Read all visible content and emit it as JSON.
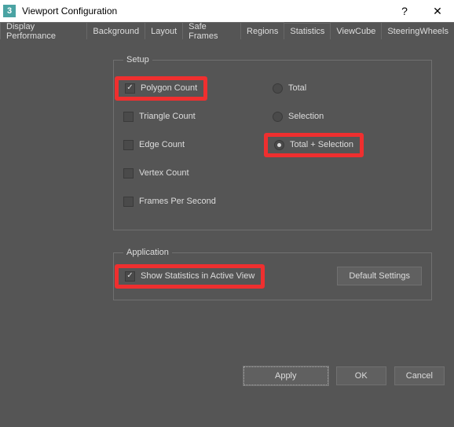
{
  "window": {
    "title": "Viewport Configuration",
    "help_icon": "?",
    "close_icon": "✕"
  },
  "tabs": {
    "t0": "Display Performance",
    "t1": "Background",
    "t2": "Layout",
    "t3": "Safe Frames",
    "t4": "Regions",
    "t5": "Statistics",
    "t6": "ViewCube",
    "t7": "SteeringWheels",
    "active": "Statistics"
  },
  "setup": {
    "legend": "Setup",
    "polygon_count": "Polygon Count",
    "triangle_count": "Triangle Count",
    "edge_count": "Edge Count",
    "vertex_count": "Vertex Count",
    "fps": "Frames Per Second",
    "total": "Total",
    "selection": "Selection",
    "total_selection": "Total + Selection"
  },
  "application": {
    "legend": "Application",
    "show_stats": "Show Statistics in Active View",
    "default_btn": "Default Settings"
  },
  "footer": {
    "apply": "Apply",
    "ok": "OK",
    "cancel": "Cancel"
  }
}
